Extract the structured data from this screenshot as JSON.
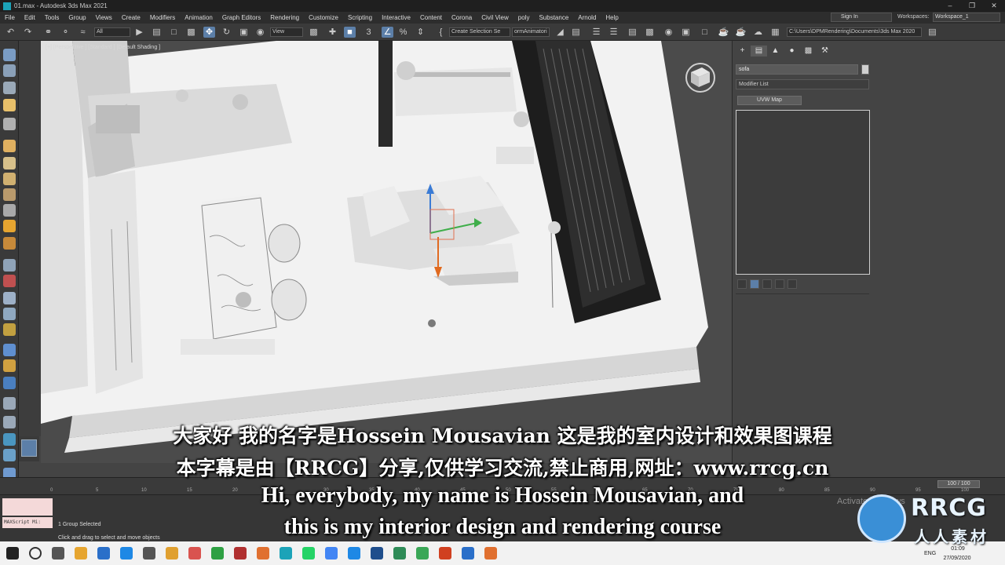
{
  "window": {
    "title": "01.max - Autodesk 3ds Max 2021"
  },
  "menu": [
    "File",
    "Edit",
    "Tools",
    "Group",
    "Views",
    "Create",
    "Modifiers",
    "Animation",
    "Graph Editors",
    "Rendering",
    "Customize",
    "Scripting",
    "Interactive",
    "Content",
    "Corona",
    "Civil View",
    "poly",
    "Substance",
    "Arnold",
    "Help"
  ],
  "account": {
    "sign_in": "Sign In",
    "workspaces_label": "Workspaces:",
    "workspace": "Workspace_1"
  },
  "toolbar": {
    "filter": "All",
    "ref_coord": "View",
    "selection_set": "Create Selection Se",
    "extra": "ormAnimatori",
    "project_path": "C:\\Users\\DPMRendering\\Documents\\3ds Max 2020"
  },
  "viewport": {
    "label": "[+] [Perspective ] [Standard ] [Default Shading ]"
  },
  "command_panel": {
    "object_name": "sofa",
    "modifier_list": "Modifier List",
    "modifier_button": "UVW Map",
    "object_color": "#cfcfcf"
  },
  "timeline": {
    "frame": "100 / 100",
    "ticks": [
      "0",
      "5",
      "10",
      "15",
      "20",
      "25",
      "30",
      "35",
      "40",
      "45",
      "50",
      "55",
      "60",
      "65",
      "70",
      "75",
      "80",
      "85",
      "90",
      "95",
      "100"
    ]
  },
  "status": {
    "maxscript": "MAXScript Mi:",
    "selection": "1 Group Selected",
    "prompt": "Click and drag to select and move objects",
    "activate": "Activate Windows"
  },
  "taskbar": {
    "lang": "ENG",
    "time": "01:09",
    "date": "27/09/2020"
  },
  "subtitles": {
    "cn1": "大家好 我的名字是Hossein Mousavian 这是我的室内设计和效果图课程",
    "cn2": "本字幕是由【RRCG】分享,仅供学习交流,禁止商用,网址：www.rrcg.cn",
    "en1": "Hi, everybody, my name is Hossein Mousavian, and",
    "en2": "this is my interior design and rendering course"
  },
  "watermark": {
    "brand": "RRCG",
    "sub": "人人素材"
  },
  "colors": {
    "selection_blue": "#5c7fa8",
    "maxscript_bg": "#f4d9d9",
    "taskbar": "#f2f2f2"
  }
}
